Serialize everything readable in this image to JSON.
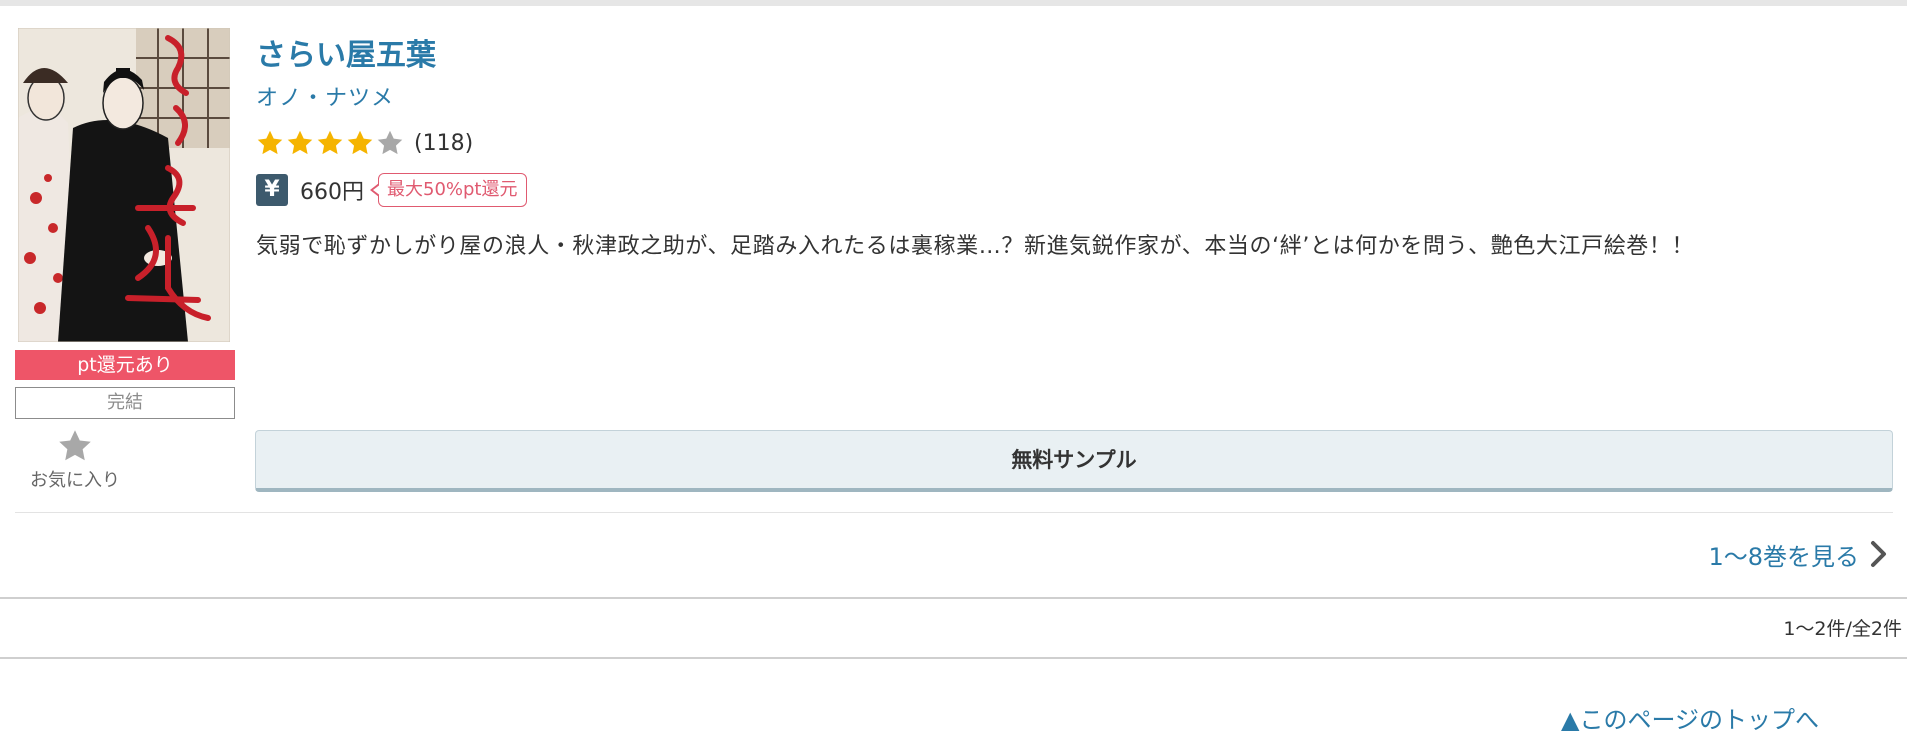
{
  "book": {
    "title": "さらい屋五葉",
    "author": "オノ・ナツメ",
    "rating_stars": 4,
    "rating_max": 5,
    "review_count": "(118)",
    "price": "660円",
    "point_tag": "最大50%pt還元",
    "description": "気弱で恥ずかしがり屋の浪人・秋津政之助が、足踏み入れたるは裏稼業…？新進気鋭作家が、本当の‘絆’とは何かを問う、艶色大江戸絵巻！！",
    "pt_badge": "pt還元あり",
    "status_badge": "完結",
    "favorite_label": "お気に入り",
    "sample_button": "無料サンプル",
    "volumes_link": "1〜8巻を見る"
  },
  "pagination": {
    "count_text": "1〜2件/全2件"
  },
  "footer": {
    "page_top_link": "▲このページのトップへ"
  },
  "colors": {
    "link_blue": "#2a7aa8",
    "star_gold": "#f5b400",
    "star_gray": "#a8a8a8",
    "pt_badge_red": "#ee5568",
    "yen_icon_bg": "#3d5a6d",
    "point_tag_red": "#e05a70"
  },
  "icons": {
    "star": "star-icon",
    "yen": "yen-icon",
    "chevron": "chevron-right-icon",
    "favorite": "favorite-star-icon"
  }
}
